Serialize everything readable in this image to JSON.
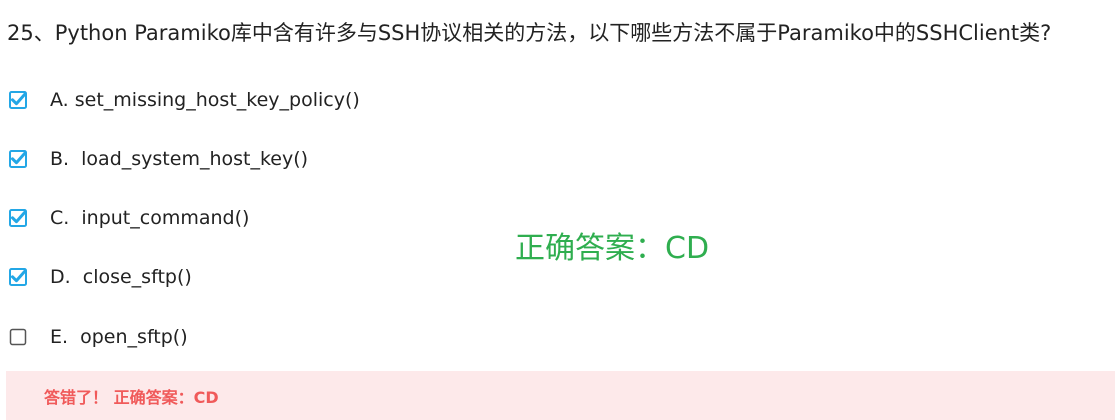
{
  "question": {
    "title": "25、Python Paramiko库中含有许多与SSH协议相关的方法，以下哪些方法不属于Paramiko中的SSHClient类?"
  },
  "options": [
    {
      "text": "A. set_missing_host_key_policy()",
      "checked": true
    },
    {
      "text": "B.  load_system_host_key()",
      "checked": true
    },
    {
      "text": "C.  input_command()",
      "checked": true
    },
    {
      "text": "D.  close_sftp()",
      "checked": true
    },
    {
      "text": "E.  open_sftp()",
      "checked": false
    }
  ],
  "overlay": {
    "text": "正确答案：CD",
    "color": "#2fae4f"
  },
  "result": {
    "text": "答错了！ 正确答案：CD",
    "bg_color": "#fde9ea",
    "text_color": "#f05a5a"
  },
  "colors": {
    "checkbox_checked": "#23a7e6",
    "checkbox_unchecked": "#555555"
  }
}
